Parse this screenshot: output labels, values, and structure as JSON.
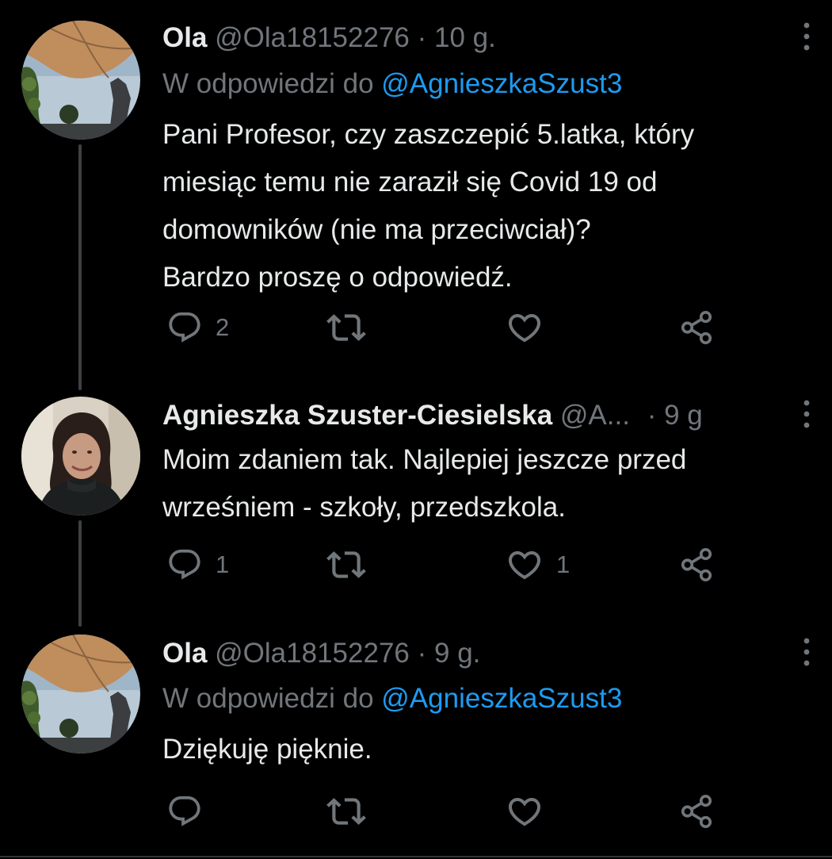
{
  "colors": {
    "background": "#000000",
    "text": "#e7e9ea",
    "muted": "#71767b",
    "link": "#1d9bf0",
    "thread_line": "#3e4144"
  },
  "icons": {
    "reply": "reply-icon",
    "retweet": "retweet-icon",
    "like": "like-icon",
    "share": "share-icon",
    "more": "more-vertical-icon"
  },
  "tweets": [
    {
      "name": "Ola",
      "handle": "@Ola18152276",
      "separator": "·",
      "time": "10 g.",
      "reply_prefix": "W odpowiedzi do",
      "reply_to": "@AgnieszkaSzust3",
      "body_lines": [
        "Pani Profesor, czy zaszczepić 5.latka, który",
        "miesiąc temu nie zaraził się Covid 19 od",
        "domowników (nie ma przeciwciał)?",
        "Bardzo proszę o odpowiedź."
      ],
      "reply_count": "2",
      "retweet_count": "",
      "like_count": ""
    },
    {
      "name": "Agnieszka Szuster-Ciesielska",
      "handle": "@A...",
      "separator": "·",
      "time": "9 g",
      "body_lines": [
        "Moim zdaniem tak. Najlepiej jeszcze przed",
        "wrześniem - szkoły, przedszkola."
      ],
      "reply_count": "1",
      "retweet_count": "",
      "like_count": "1"
    },
    {
      "name": "Ola",
      "handle": "@Ola18152276",
      "separator": "·",
      "time": "9 g.",
      "reply_prefix": "W odpowiedzi do",
      "reply_to": "@AgnieszkaSzust3",
      "body_lines": [
        "Dziękuję pięknie."
      ],
      "reply_count": "",
      "retweet_count": "",
      "like_count": ""
    }
  ]
}
